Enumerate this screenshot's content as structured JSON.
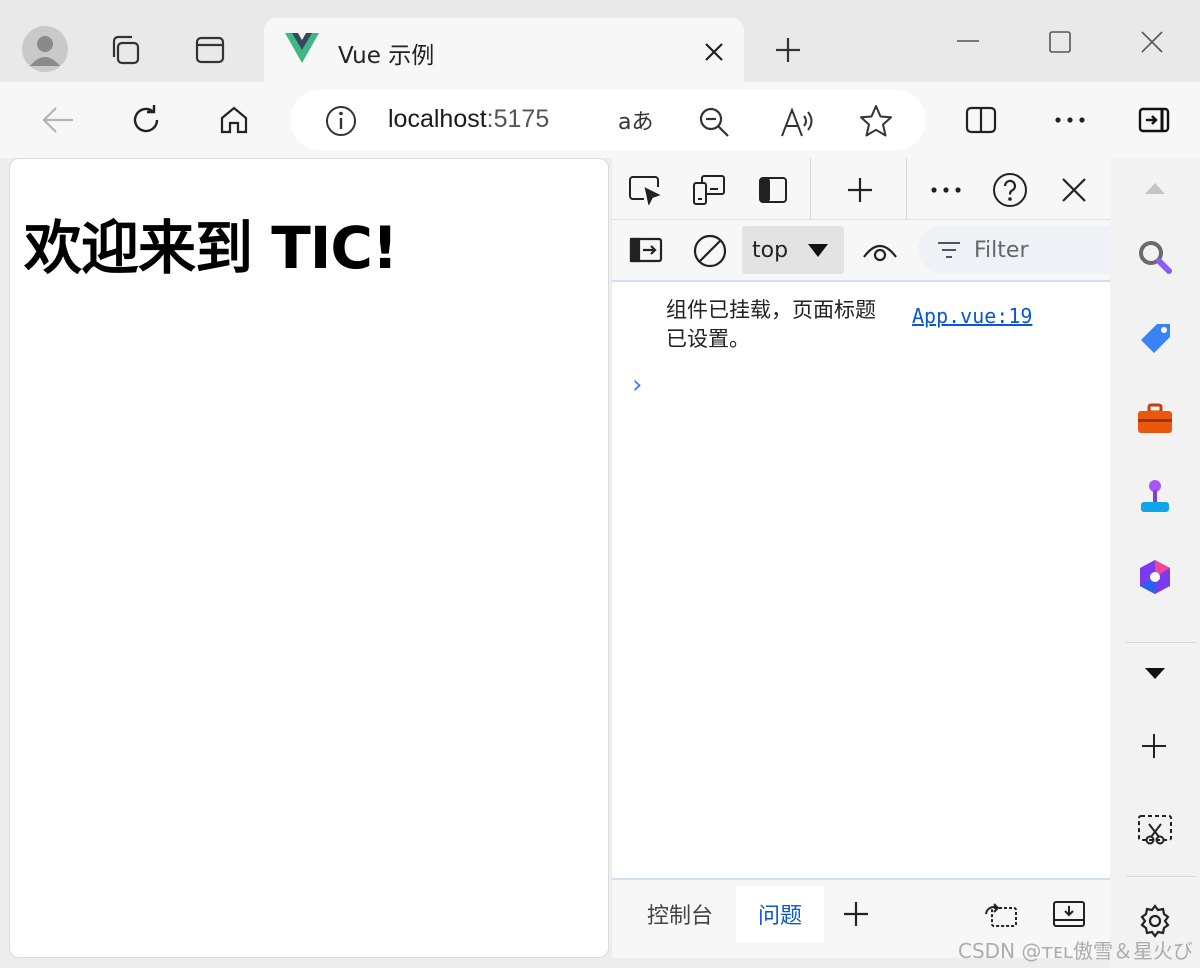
{
  "browser": {
    "tab": {
      "title": "Vue 示例"
    },
    "address": {
      "host": "localhost",
      "port": ":5175"
    }
  },
  "page": {
    "heading": "欢迎来到 TIC!"
  },
  "devtools": {
    "context": "top",
    "filter_placeholder": "Filter",
    "console": [
      {
        "message": "组件已挂载，页面标题已设置。",
        "source": "App.vue:19"
      }
    ],
    "prompt": "›",
    "bottom_tabs": [
      {
        "label": "控制台",
        "active": false
      },
      {
        "label": "问题",
        "active": true
      }
    ]
  },
  "watermark": "CSDN @ᴛᴇʟ傲雪＆星火び",
  "colors": {
    "vue_green": "#41b883",
    "vue_dark": "#35495e",
    "link": "#0b57d0",
    "accent": "#0b57d0"
  }
}
